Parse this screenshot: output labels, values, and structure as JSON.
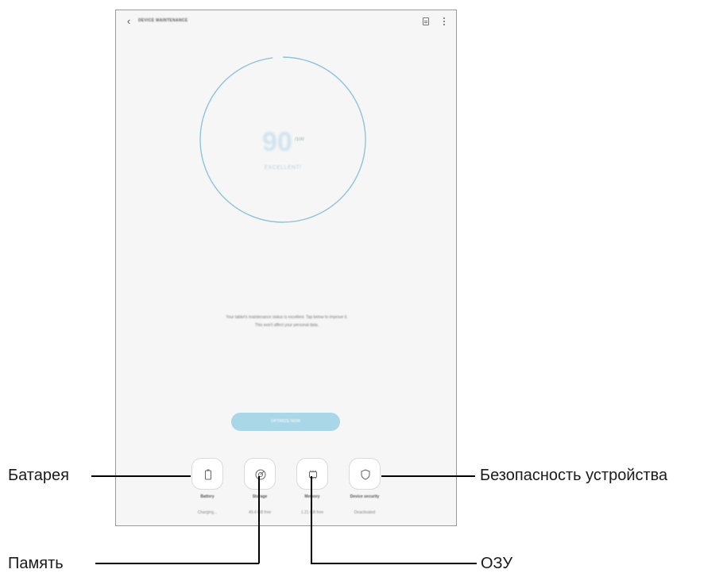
{
  "screen": {
    "title": "DEVICE MAINTENANCE",
    "back_icon": "chevron-left-icon",
    "report_icon": "document-icon",
    "menu_icon": "more-vertical-icon"
  },
  "score": {
    "value": "90",
    "max": "/100",
    "status": "EXCELLENT!",
    "gauge_fraction": 0.98,
    "accent": "#8ec3dc"
  },
  "description": {
    "line1": "Your tablet's maintenance status is excellent. Tap below to improve it.",
    "line2": "This won't affect your personal data."
  },
  "optimize_button": {
    "label": "OPTIMIZE NOW",
    "color": "#a9d7e8"
  },
  "tools": [
    {
      "label": "Battery",
      "sub": "Charging...",
      "icon": "battery-icon"
    },
    {
      "label": "Storage",
      "sub": "49.4 GB free",
      "icon": "storage-icon"
    },
    {
      "label": "Memory",
      "sub": "1.21 GB free",
      "icon": "memory-chip-icon"
    },
    {
      "label": "Device security",
      "sub": "Deactivated",
      "icon": "shield-icon"
    }
  ],
  "callouts": {
    "battery": "Батарея",
    "storage": "Память",
    "memory": "ОЗУ",
    "security": "Безопасность устройства"
  }
}
